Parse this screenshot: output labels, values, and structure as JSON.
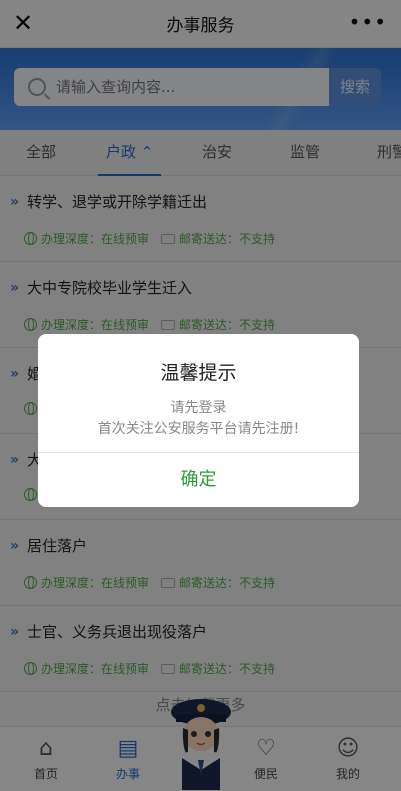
{
  "header": {
    "title": "办事服务",
    "close_icon": "close-icon",
    "more_label": "•••"
  },
  "search": {
    "placeholder": "请输入查询内容...",
    "button_label": "搜索"
  },
  "tabs": [
    {
      "label": "全部"
    },
    {
      "label": "户政 ⌃",
      "active": true
    },
    {
      "label": "治安"
    },
    {
      "label": "监管"
    },
    {
      "label": "刑警"
    }
  ],
  "items": [
    {
      "name": "转学、退学或开除学籍迁出",
      "depth": "办理深度：在线预审",
      "ship": "邮寄送达：不支持"
    },
    {
      "name": "大中专院校毕业学生迁入",
      "depth": "办理深度：在线预审",
      "ship": "邮寄送达：不支持"
    },
    {
      "name": "婚",
      "depth": "",
      "ship": ""
    },
    {
      "name": "大",
      "depth": "",
      "ship": ""
    },
    {
      "name": "居住落户",
      "depth": "办理深度：在线预审",
      "ship": "邮寄送达：不支持"
    },
    {
      "name": "士官、义务兵退出现役落户",
      "depth": "办理深度：在线预审",
      "ship": "邮寄送达：不支持"
    }
  ],
  "load_more": "点击加载更多",
  "bottom_nav": [
    {
      "label": "首页",
      "icon": "home-icon"
    },
    {
      "label": "办事",
      "icon": "book-icon",
      "active": true
    },
    {
      "label": "便民",
      "icon": "heart-hand-icon"
    },
    {
      "label": "我的",
      "icon": "user-icon"
    }
  ],
  "dialog": {
    "title": "温馨提示",
    "line1": "请先登录",
    "line2": "首次关注公安服务平台请先注册!",
    "confirm_label": "确定"
  },
  "colors": {
    "accent": "#2a67c9",
    "confirm": "#2e9b3c",
    "meta": "#52a34a"
  }
}
